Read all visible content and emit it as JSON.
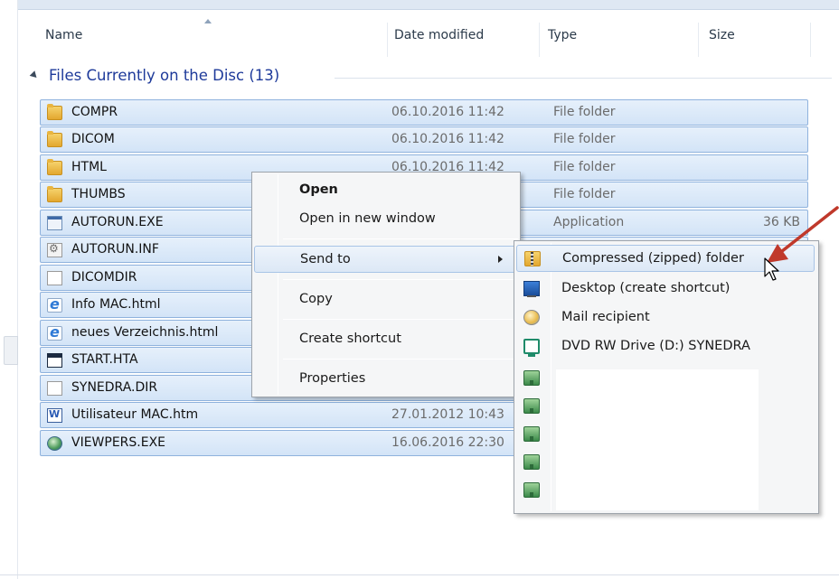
{
  "columns": {
    "name": "Name",
    "date_modified": "Date modified",
    "type": "Type",
    "size": "Size"
  },
  "group": {
    "title": "Files Currently on the Disc (13)"
  },
  "files": [
    {
      "name": "COMPR",
      "date": "06.10.2016 11:42",
      "type": "File folder",
      "size": "",
      "icon": "folder-icon"
    },
    {
      "name": "DICOM",
      "date": "06.10.2016 11:42",
      "type": "File folder",
      "size": "",
      "icon": "folder-icon"
    },
    {
      "name": "HTML",
      "date": "06.10.2016 11:42",
      "type": "File folder",
      "size": "",
      "icon": "folder-icon"
    },
    {
      "name": "THUMBS",
      "date": "",
      "type": "File folder",
      "size": "",
      "icon": "folder-icon"
    },
    {
      "name": "AUTORUN.EXE",
      "date": "",
      "type": "Application",
      "size": "36 KB",
      "icon": "application-icon"
    },
    {
      "name": "AUTORUN.INF",
      "date": "",
      "type": "",
      "size": "",
      "icon": "settings-file-icon"
    },
    {
      "name": "DICOMDIR",
      "date": "",
      "type": "",
      "size": "",
      "icon": "blank-file-icon"
    },
    {
      "name": "Info MAC.html",
      "date": "",
      "type": "",
      "size": "",
      "icon": "html-file-icon"
    },
    {
      "name": "neues Verzeichnis.html",
      "date": "",
      "type": "",
      "size": "",
      "icon": "html-file-icon"
    },
    {
      "name": "START.HTA",
      "date": "",
      "type": "",
      "size": "",
      "icon": "hta-file-icon"
    },
    {
      "name": "SYNEDRA.DIR",
      "date": "",
      "type": "",
      "size": "",
      "icon": "blank-file-icon"
    },
    {
      "name": "Utilisateur MAC.htm",
      "date": "27.01.2012 10:43",
      "type": "",
      "size": "",
      "icon": "word-file-icon"
    },
    {
      "name": "VIEWPERS.EXE",
      "date": "16.06.2016 22:30",
      "type": "",
      "size": "",
      "icon": "globe-app-icon"
    }
  ],
  "context_menu": {
    "open": "Open",
    "open_new_window": "Open in new window",
    "send_to": "Send to",
    "copy": "Copy",
    "create_shortcut": "Create shortcut",
    "properties": "Properties"
  },
  "send_to_menu": {
    "compressed": "Compressed (zipped) folder",
    "desktop": "Desktop (create shortcut)",
    "mail": "Mail recipient",
    "dvd": "DVD RW Drive (D:) SYNEDRA"
  },
  "colors": {
    "group_title": "#1e3a9a",
    "selection": "#d3e4f7",
    "annotation_arrow": "#c0392b"
  }
}
